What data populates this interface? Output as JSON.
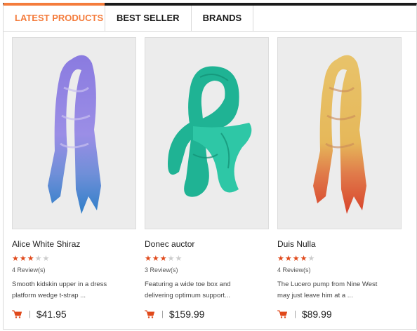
{
  "tabs": [
    {
      "label": "LATEST PRODUCTS",
      "active": true
    },
    {
      "label": "BEST SELLER",
      "active": false
    },
    {
      "label": "BRANDS",
      "active": false
    }
  ],
  "colors": {
    "accent": "#f47c3c",
    "star_on": "#e0491b",
    "star_off": "#cccccc",
    "top_bar": "#1a1a1a"
  },
  "products": [
    {
      "title": "Alice White Shiraz",
      "rating": 3,
      "max_rating": 5,
      "reviews": "4 Review(s)",
      "description_1": "Smooth kidskin upper in a dress",
      "description_2": "platform wedge t-strap ...",
      "price": "$41.95",
      "image": "purple-blue-scarf"
    },
    {
      "title": "Donec auctor",
      "rating": 3,
      "max_rating": 5,
      "reviews": "3 Review(s)",
      "description_1": "Featuring a wide toe box and",
      "description_2": "delivering optimum support...",
      "price": "$159.99",
      "image": "teal-scarf"
    },
    {
      "title": "Duis Nulla",
      "rating": 4,
      "max_rating": 5,
      "reviews": "4 Review(s)",
      "description_1": "The Lucero pump from Nine West",
      "description_2": "may just leave him at a ...",
      "price": "$89.99",
      "image": "yellow-red-scarf"
    }
  ]
}
